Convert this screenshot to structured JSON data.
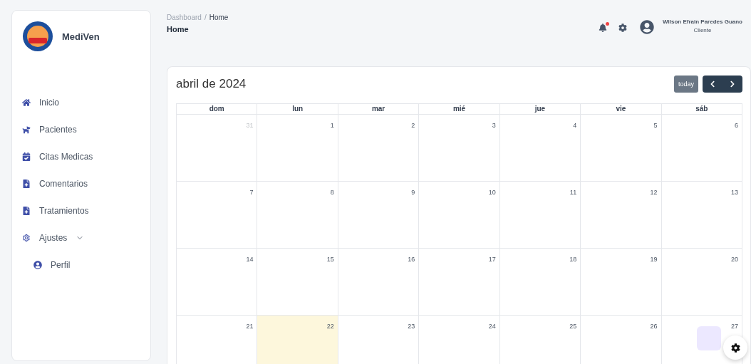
{
  "sidebar": {
    "brand": "MediVen",
    "items": [
      {
        "label": "Inicio"
      },
      {
        "label": "Pacientes"
      },
      {
        "label": "Citas Medicas"
      },
      {
        "label": "Comentarios"
      },
      {
        "label": "Tratamientos"
      },
      {
        "label": "Ajustes",
        "expanded": true,
        "children": [
          {
            "label": "Perfil"
          }
        ]
      }
    ]
  },
  "header": {
    "breadcrumb": [
      "Dashboard",
      "Home"
    ],
    "breadcrumb_separator": "/",
    "page_title": "Home",
    "notifications_unread": true,
    "user": {
      "name": "Wilson Efrain Paredes Guano",
      "role": "Cliente"
    }
  },
  "calendar": {
    "title": "abril de 2024",
    "today_button": "today",
    "weekdays": [
      "dom",
      "lun",
      "mar",
      "mié",
      "jue",
      "vie",
      "sáb"
    ],
    "weeks": [
      [
        {
          "day": "31",
          "other_month": true,
          "today": false
        },
        {
          "day": "1",
          "other_month": false,
          "today": false
        },
        {
          "day": "2",
          "other_month": false,
          "today": false
        },
        {
          "day": "3",
          "other_month": false,
          "today": false
        },
        {
          "day": "4",
          "other_month": false,
          "today": false
        },
        {
          "day": "5",
          "other_month": false,
          "today": false
        },
        {
          "day": "6",
          "other_month": false,
          "today": false
        }
      ],
      [
        {
          "day": "7",
          "other_month": false,
          "today": false
        },
        {
          "day": "8",
          "other_month": false,
          "today": false
        },
        {
          "day": "9",
          "other_month": false,
          "today": false
        },
        {
          "day": "10",
          "other_month": false,
          "today": false
        },
        {
          "day": "11",
          "other_month": false,
          "today": false
        },
        {
          "day": "12",
          "other_month": false,
          "today": false
        },
        {
          "day": "13",
          "other_month": false,
          "today": false
        }
      ],
      [
        {
          "day": "14",
          "other_month": false,
          "today": false
        },
        {
          "day": "15",
          "other_month": false,
          "today": false
        },
        {
          "day": "16",
          "other_month": false,
          "today": false
        },
        {
          "day": "17",
          "other_month": false,
          "today": false
        },
        {
          "day": "18",
          "other_month": false,
          "today": false
        },
        {
          "day": "19",
          "other_month": false,
          "today": false
        },
        {
          "day": "20",
          "other_month": false,
          "today": false
        }
      ],
      [
        {
          "day": "21",
          "other_month": false,
          "today": false
        },
        {
          "day": "22",
          "other_month": false,
          "today": true
        },
        {
          "day": "23",
          "other_month": false,
          "today": false
        },
        {
          "day": "24",
          "other_month": false,
          "today": false
        },
        {
          "day": "25",
          "other_month": false,
          "today": false
        },
        {
          "day": "26",
          "other_month": false,
          "today": false
        },
        {
          "day": "27",
          "other_month": false,
          "today": false
        }
      ]
    ]
  }
}
